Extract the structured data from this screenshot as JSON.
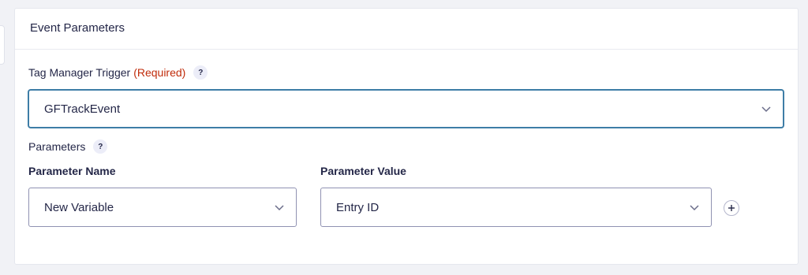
{
  "panel": {
    "title": "Event Parameters"
  },
  "trigger": {
    "label": "Tag Manager Trigger",
    "required": "(Required)",
    "help": "?",
    "value": "GFTrackEvent"
  },
  "parameters": {
    "label": "Parameters",
    "help": "?",
    "name_header": "Parameter Name",
    "value_header": "Parameter Value",
    "rows": [
      {
        "name": "New Variable",
        "value": "Entry ID"
      }
    ]
  },
  "icons": {
    "dropdown": "chevron-down-icon",
    "add": "plus-circle-icon"
  },
  "colors": {
    "required": "#c02b0a",
    "focus_border": "#3e7da6",
    "text": "#242748"
  }
}
